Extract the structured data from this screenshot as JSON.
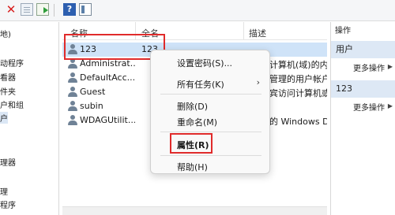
{
  "toolbar": {
    "close_icon": "✕",
    "help_label": "?"
  },
  "tree": {
    "items": [
      "地)",
      "动程序",
      "看器",
      "件夹",
      "户和组",
      "户",
      "理器",
      "理",
      "程序"
    ]
  },
  "list": {
    "columns": {
      "name": "名称",
      "full_name": "全名",
      "description": "描述"
    },
    "rows": [
      {
        "name": "123",
        "full_name": "123",
        "description": ""
      },
      {
        "name": "Administrat...",
        "full_name": "",
        "description": "计算机(域)的内"
      },
      {
        "name": "DefaultAcc...",
        "full_name": "",
        "description": "管理的用户帐户"
      },
      {
        "name": "Guest",
        "full_name": "",
        "description": "宾访问计算机或"
      },
      {
        "name": "subin",
        "full_name": "",
        "description": ""
      },
      {
        "name": "WDAGUtilit...",
        "full_name": "",
        "description": "的 Windows D"
      }
    ]
  },
  "context_menu": {
    "items": [
      "设置密码(S)...",
      "所有任务(K)",
      "删除(D)",
      "重命名(M)",
      "属性(R)",
      "帮助(H)"
    ],
    "submenu_arrow": "›"
  },
  "actions": {
    "header": "操作",
    "sections": [
      {
        "title": "用户",
        "more": "更多操作",
        "arrow": "▶"
      },
      {
        "title": "123",
        "more": "更多操作",
        "arrow": "▶"
      }
    ]
  },
  "colors": {
    "highlight_red": "#e02b2b",
    "selection": "#cfe3f8",
    "actions_section": "#dde8f5"
  }
}
